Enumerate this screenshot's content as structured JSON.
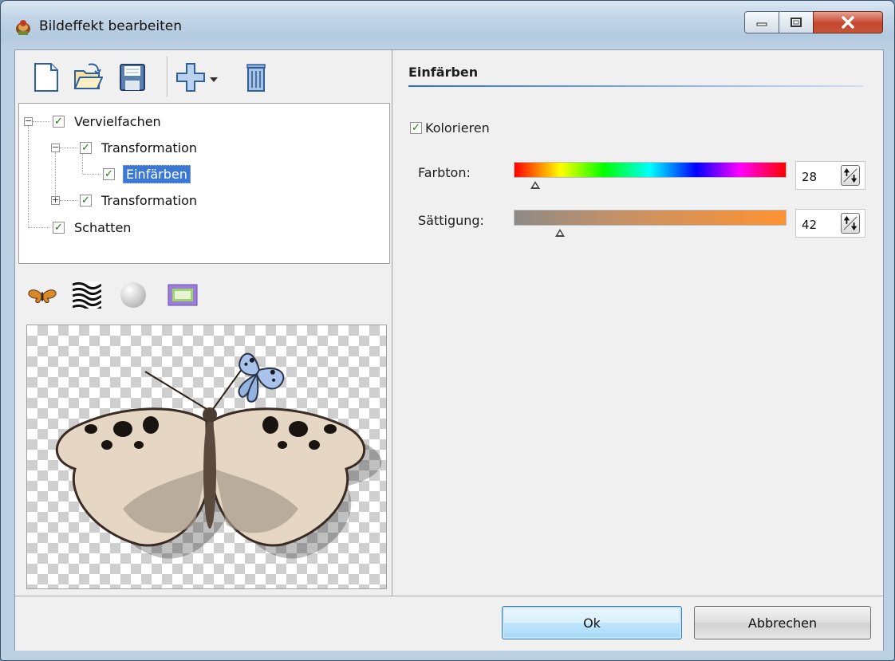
{
  "window": {
    "title": "Bildeffekt bearbeiten",
    "app_icon": "effects-app-icon",
    "controls": [
      "minimize-icon",
      "maximize-icon",
      "close-icon"
    ]
  },
  "toolbar": {
    "items": [
      "new-document-icon",
      "open-folder-icon",
      "save-disk-icon",
      "add-effect-icon",
      "dropdown-arrow-icon",
      "delete-trash-icon"
    ]
  },
  "tree": {
    "nodes": [
      {
        "label": "Vervielfachen",
        "checked": true,
        "expanded": true
      },
      {
        "label": "Transformation",
        "checked": true,
        "expanded": true
      },
      {
        "label": "Einfärben",
        "checked": true,
        "selected": true
      },
      {
        "label": "Transformation",
        "checked": true,
        "expanded": false
      },
      {
        "label": "Schatten",
        "checked": true
      }
    ]
  },
  "preview_tools": [
    "butterfly-thumbnail-icon",
    "zebra-pattern-icon",
    "sphere-icon",
    "frame-icon"
  ],
  "settings": {
    "section_title": "Einfärben",
    "colorize_label": "Kolorieren",
    "colorize_checked": true,
    "hue_label": "Farbton:",
    "hue_value": "28",
    "hue_fraction": 0.08,
    "saturation_label": "Sättigung:",
    "saturation_value": "42",
    "saturation_fraction": 0.17
  },
  "footer": {
    "ok_label": "Ok",
    "cancel_label": "Abbrechen"
  },
  "colors": {
    "selection": "#3a78d4",
    "section_line": "#2b6fcf",
    "close_button": "#c7452f"
  }
}
